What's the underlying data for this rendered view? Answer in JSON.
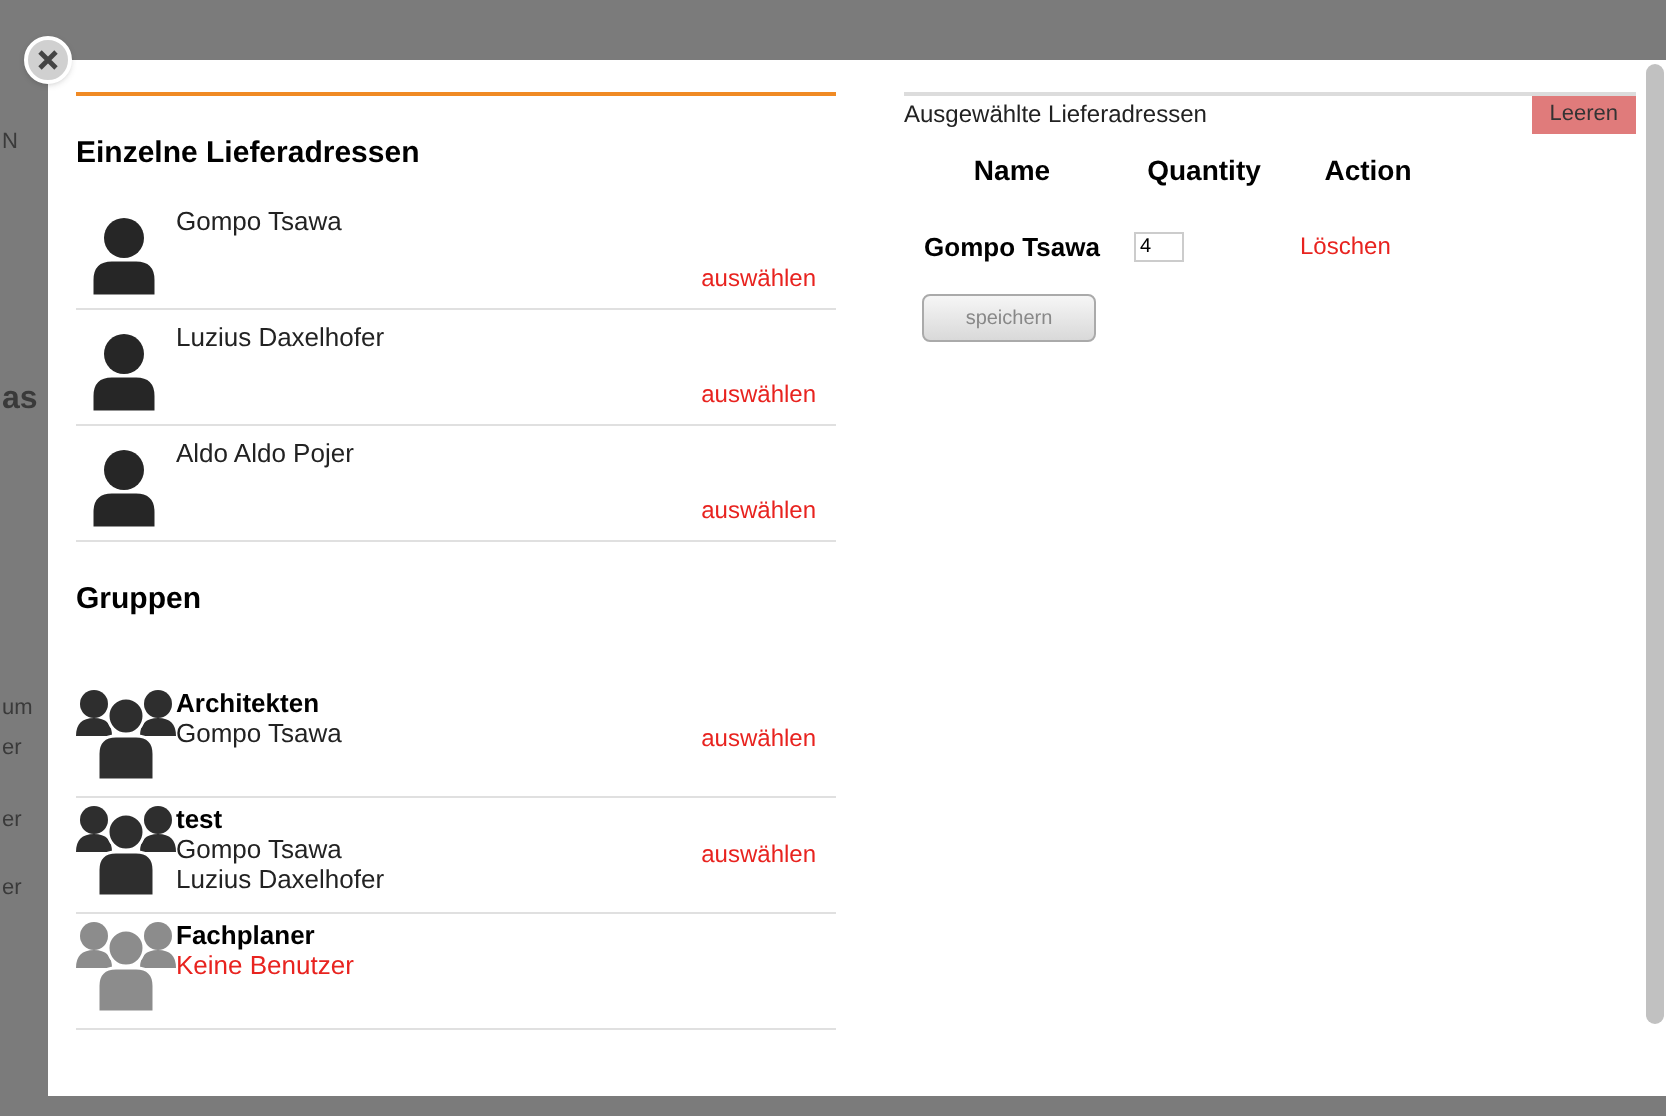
{
  "background_fragments": [
    "N",
    "as",
    "um",
    "er",
    "er",
    "er"
  ],
  "left": {
    "section_title": "Einzelne Lieferadressen",
    "people": [
      {
        "name": "Gompo Tsawa",
        "action": "auswählen"
      },
      {
        "name": "Luzius Daxelhofer",
        "action": "auswählen"
      },
      {
        "name": "Aldo Aldo Pojer",
        "action": "auswählen"
      }
    ],
    "groups_title": "Gruppen",
    "groups": [
      {
        "name": "Architekten",
        "members": [
          "Gompo Tsawa"
        ],
        "action": "auswählen",
        "disabled": false
      },
      {
        "name": "test",
        "members": [
          "Gompo Tsawa",
          "Luzius Daxelhofer"
        ],
        "action": "auswählen",
        "disabled": false
      },
      {
        "name": "Fachplaner",
        "note": "Keine Benutzer",
        "disabled": true
      }
    ]
  },
  "right": {
    "title": "Ausgewählte Lieferadressen",
    "clear_button": "Leeren",
    "columns": [
      "Name",
      "Quantity",
      "Action"
    ],
    "rows": [
      {
        "name": "Gompo Tsawa",
        "quantity": "4",
        "action": "Löschen"
      }
    ],
    "save_button": "speichern"
  }
}
